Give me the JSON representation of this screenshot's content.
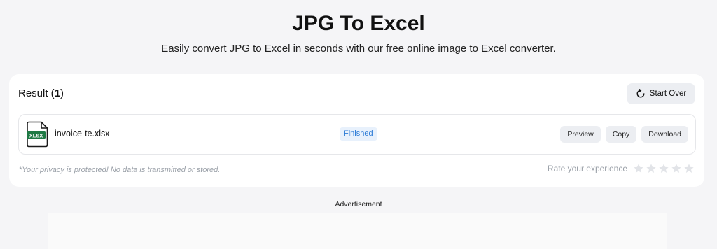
{
  "header": {
    "title": "JPG To Excel",
    "subtitle": "Easily convert JPG to Excel in seconds with our free online image to Excel converter."
  },
  "result": {
    "label": "Result (",
    "count": "1",
    "label_end": ")",
    "start_over_label": "Start Over",
    "file": {
      "icon_text": "XLSX",
      "name": "invoice-te.xlsx",
      "status": "Finished",
      "preview_label": "Preview",
      "copy_label": "Copy",
      "download_label": "Download"
    },
    "privacy_note": "*Your privacy is protected! No data is transmitted or stored.",
    "rate_label": "Rate your experience",
    "stars_total": 5,
    "stars_filled": 0
  },
  "ad": {
    "label": "Advertisement"
  },
  "colors": {
    "status_text": "#2b7bd6",
    "status_bg": "#e8f1fc",
    "xlsx_green": "#1f7a45",
    "star_empty": "#e2e4e8"
  }
}
